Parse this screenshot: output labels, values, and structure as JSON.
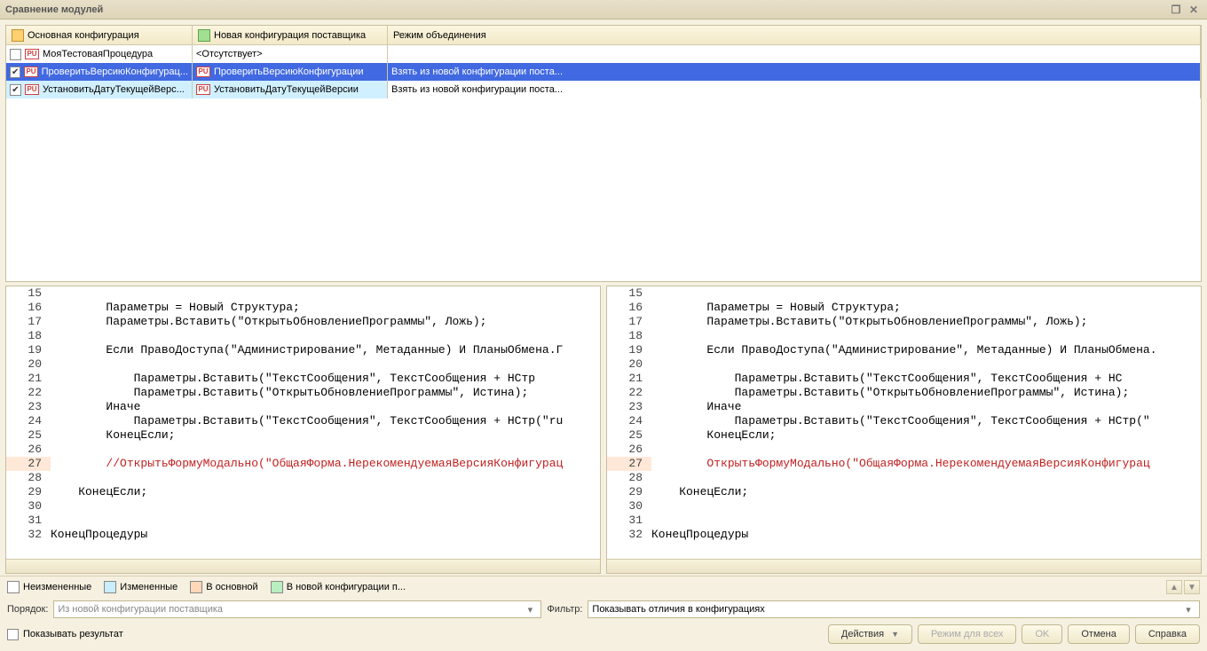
{
  "title": "Сравнение модулей",
  "table": {
    "header": {
      "col1": "Основная конфигурация",
      "col2": "Новая конфигурация поставщика",
      "col3": "Режим объединения"
    },
    "rows": [
      {
        "checked": false,
        "name1": "МояТестоваяПроцедура",
        "name2": "<Отсутствует>",
        "mode": "",
        "has_icon2": false
      },
      {
        "checked": true,
        "name1": "ПроверитьВерсиюКонфигурац...",
        "name2": "ПроверитьВерсиюКонфигурации",
        "mode": "Взять из новой конфигурации поста...",
        "has_icon2": true,
        "selected": true
      },
      {
        "checked": true,
        "name1": "УстановитьДатуТекущейВерс...",
        "name2": "УстановитьДатуТекущейВерсии",
        "mode": "Взять из новой конфигурации поста...",
        "has_icon2": true,
        "changed": true
      }
    ]
  },
  "code_left": [
    {
      "n": "15",
      "t": ""
    },
    {
      "n": "16",
      "t": "        Параметры = Новый Структура;"
    },
    {
      "n": "17",
      "t": "        Параметры.Вставить(\"ОткрытьОбновлениеПрограммы\", Ложь);"
    },
    {
      "n": "18",
      "t": ""
    },
    {
      "n": "19",
      "t": "        Если ПравоДоступа(\"Администрирование\", Метаданные) И ПланыОбмена.Г"
    },
    {
      "n": "20",
      "t": ""
    },
    {
      "n": "21",
      "t": "            Параметры.Вставить(\"ТекстСообщения\", ТекстСообщения + НСтр"
    },
    {
      "n": "22",
      "t": "            Параметры.Вставить(\"ОткрытьОбновлениеПрограммы\", Истина);"
    },
    {
      "n": "23",
      "t": "        Иначе"
    },
    {
      "n": "24",
      "t": "            Параметры.Вставить(\"ТекстСообщения\", ТекстСообщения + НСтр(\"ru"
    },
    {
      "n": "25",
      "t": "        КонецЕсли;"
    },
    {
      "n": "26",
      "t": ""
    },
    {
      "n": "27",
      "t": "        //ОткрытьФормуМодально(\"ОбщаяФорма.НерекомендуемаяВерсияКонфигурац",
      "diff": true
    },
    {
      "n": "28",
      "t": ""
    },
    {
      "n": "29",
      "t": "    КонецЕсли;"
    },
    {
      "n": "30",
      "t": ""
    },
    {
      "n": "31",
      "t": ""
    },
    {
      "n": "32",
      "t": "КонецПроцедуры"
    }
  ],
  "code_right": [
    {
      "n": "15",
      "t": ""
    },
    {
      "n": "16",
      "t": "        Параметры = Новый Структура;"
    },
    {
      "n": "17",
      "t": "        Параметры.Вставить(\"ОткрытьОбновлениеПрограммы\", Ложь);"
    },
    {
      "n": "18",
      "t": ""
    },
    {
      "n": "19",
      "t": "        Если ПравоДоступа(\"Администрирование\", Метаданные) И ПланыОбмена."
    },
    {
      "n": "20",
      "t": ""
    },
    {
      "n": "21",
      "t": "            Параметры.Вставить(\"ТекстСообщения\", ТекстСообщения + НС"
    },
    {
      "n": "22",
      "t": "            Параметры.Вставить(\"ОткрытьОбновлениеПрограммы\", Истина);"
    },
    {
      "n": "23",
      "t": "        Иначе"
    },
    {
      "n": "24",
      "t": "            Параметры.Вставить(\"ТекстСообщения\", ТекстСообщения + НСтр(\""
    },
    {
      "n": "25",
      "t": "        КонецЕсли;"
    },
    {
      "n": "26",
      "t": ""
    },
    {
      "n": "27",
      "t": "        ОткрытьФормуМодально(\"ОбщаяФорма.НерекомендуемаяВерсияКонфигурац",
      "diff": true
    },
    {
      "n": "28",
      "t": ""
    },
    {
      "n": "29",
      "t": "    КонецЕсли;"
    },
    {
      "n": "30",
      "t": ""
    },
    {
      "n": "31",
      "t": ""
    },
    {
      "n": "32",
      "t": "КонецПроцедуры"
    }
  ],
  "legend": {
    "unchanged": "Неизмененные",
    "changed": "Измененные",
    "in_main": "В основной",
    "in_new": "В новой конфигурации п..."
  },
  "order_label": "Порядок:",
  "order_value": "Из новой конфигурации поставщика",
  "filter_label": "Фильтр:",
  "filter_value": "Показывать отличия в конфигурациях",
  "show_result": "Показывать результат",
  "buttons": {
    "actions": "Действия",
    "mode_all": "Режим для всех",
    "ok": "OK",
    "cancel": "Отмена",
    "help": "Справка"
  }
}
